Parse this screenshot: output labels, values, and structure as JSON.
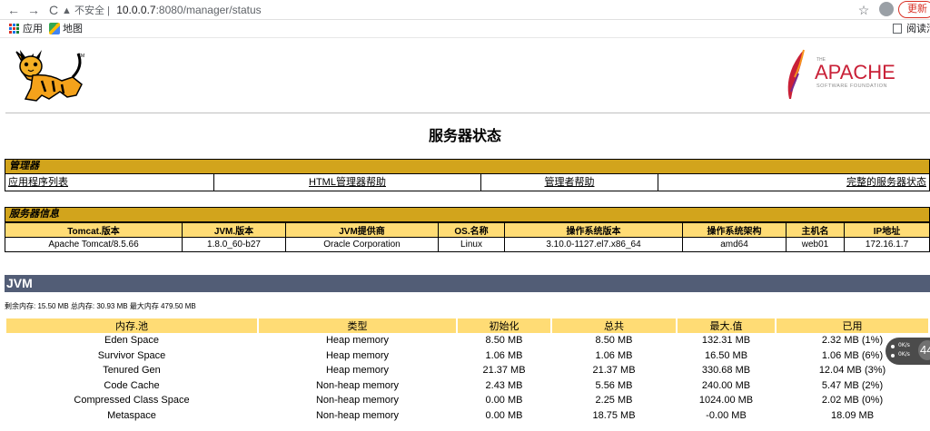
{
  "browser": {
    "back_icon": "←",
    "forward_icon": "→",
    "reload_icon": "C",
    "security_label": "▲ 不安全 |",
    "url_host": "10.0.0.7",
    "url_path": ":8080/manager/status",
    "update_label": "更新",
    "bookmarks": {
      "apps": "应用",
      "maps": "地图",
      "reading_list": "阅读清单"
    }
  },
  "page": {
    "title": "服务器状态",
    "logos": {
      "tomcat_tm": "TM",
      "apache_the": "THE",
      "apache_name": "APACHE",
      "apache_sub": "SOFTWARE FOUNDATION"
    }
  },
  "manager": {
    "heading": "管理器",
    "links": [
      "应用程序列表",
      "HTML管理器帮助",
      "管理者帮助",
      "完整的服务器状态"
    ]
  },
  "server_info": {
    "heading": "服务器信息",
    "headers": [
      "Tomcat.版本",
      "JVM.版本",
      "JVM提供商",
      "OS.名称",
      "操作系统版本",
      "操作系统架构",
      "主机名",
      "IP地址"
    ],
    "row": [
      "Apache Tomcat/8.5.66",
      "1.8.0_60-b27",
      "Oracle Corporation",
      "Linux",
      "3.10.0-1127.el7.x86_64",
      "amd64",
      "web01",
      "172.16.1.7"
    ]
  },
  "jvm": {
    "heading": "JVM",
    "memory_summary": "剩余内存:  15.50 MB 总内存:  30.93 MB 最大内存 479.50 MB",
    "pool_headers": [
      "内存.池",
      "类型",
      "初始化",
      "总共",
      "最大.值",
      "已用"
    ],
    "pools": [
      [
        "Eden Space",
        "Heap memory",
        "8.50 MB",
        "8.50 MB",
        "132.31 MB",
        "2.32 MB (1%)"
      ],
      [
        "Survivor Space",
        "Heap memory",
        "1.06 MB",
        "1.06 MB",
        "16.50 MB",
        "1.06 MB (6%)"
      ],
      [
        "Tenured Gen",
        "Heap memory",
        "21.37 MB",
        "21.37 MB",
        "330.68 MB",
        "12.04 MB (3%)"
      ],
      [
        "Code Cache",
        "Non-heap memory",
        "2.43 MB",
        "5.56 MB",
        "240.00 MB",
        "5.47 MB (2%)"
      ],
      [
        "Compressed Class Space",
        "Non-heap memory",
        "0.00 MB",
        "2.25 MB",
        "1024.00 MB",
        "2.02 MB (0%)"
      ],
      [
        "Metaspace",
        "Non-heap memory",
        "0.00 MB",
        "18.75 MB",
        "-0.00 MB",
        "18.09 MB"
      ]
    ]
  },
  "widget": {
    "up": "0K/s",
    "down": "0K/s",
    "value": "44"
  }
}
